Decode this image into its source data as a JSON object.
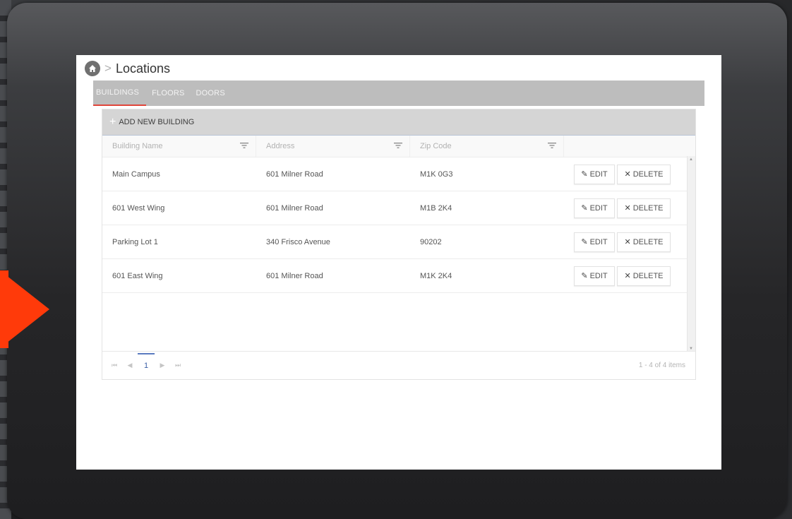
{
  "breadcrumb": {
    "separator": ">",
    "title": "Locations"
  },
  "tabs": [
    {
      "label": "BUILDINGS",
      "active": true
    },
    {
      "label": "FLOORS",
      "active": false
    },
    {
      "label": "DOORS",
      "active": false
    }
  ],
  "toolbar": {
    "add_label": "ADD NEW BUILDING",
    "add_icon": "plus-icon"
  },
  "columns": [
    {
      "label": "Building Name"
    },
    {
      "label": "Address"
    },
    {
      "label": "Zip Code"
    }
  ],
  "rows": [
    {
      "name": "Main Campus",
      "address": "601 Milner Road",
      "zip": "M1K 0G3"
    },
    {
      "name": "601 West Wing",
      "address": "601 Milner Road",
      "zip": "M1B 2K4"
    },
    {
      "name": "Parking Lot 1",
      "address": "340 Frisco Avenue",
      "zip": "90202"
    },
    {
      "name": "601 East Wing",
      "address": "601 Milner Road",
      "zip": "M1K 2K4"
    }
  ],
  "row_actions": {
    "edit_label": "EDIT",
    "delete_label": "DELETE",
    "edit_icon": "pencil-icon",
    "delete_icon": "x-icon"
  },
  "pager": {
    "first": "⏮",
    "prev": "◀",
    "current_page": "1",
    "next": "▶",
    "last": "⏭",
    "info": "1 - 4 of 4 items"
  },
  "colors": {
    "accent_arrow": "#ff3a0a",
    "active_tab": "#e0453a",
    "tabbar": "#bdbdbd",
    "toolbar": "#d5d5d5",
    "page_active": "#3a5fa6"
  }
}
